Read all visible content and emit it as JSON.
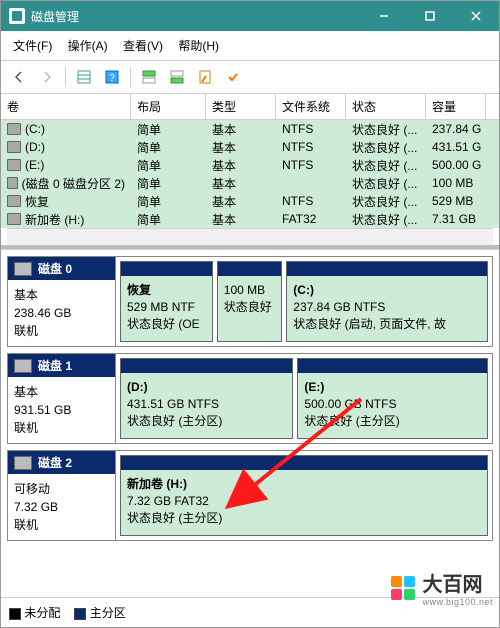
{
  "window": {
    "title": "磁盘管理"
  },
  "menu": {
    "file": "文件(F)",
    "action": "操作(A)",
    "view": "查看(V)",
    "help": "帮助(H)"
  },
  "columns": {
    "vol": "卷",
    "layout": "布局",
    "type": "类型",
    "fs": "文件系统",
    "status": "状态",
    "cap": "容量"
  },
  "rows": [
    {
      "vol": "(C:)",
      "layout": "简单",
      "type": "基本",
      "fs": "NTFS",
      "status": "状态良好 (...",
      "cap": "237.84 G"
    },
    {
      "vol": "(D:)",
      "layout": "简单",
      "type": "基本",
      "fs": "NTFS",
      "status": "状态良好 (...",
      "cap": "431.51 G"
    },
    {
      "vol": "(E:)",
      "layout": "简单",
      "type": "基本",
      "fs": "NTFS",
      "status": "状态良好 (...",
      "cap": "500.00 G"
    },
    {
      "vol": "(磁盘 0 磁盘分区 2)",
      "layout": "简单",
      "type": "基本",
      "fs": "",
      "status": "状态良好 (...",
      "cap": "100 MB"
    },
    {
      "vol": "恢复",
      "layout": "简单",
      "type": "基本",
      "fs": "NTFS",
      "status": "状态良好 (...",
      "cap": "529 MB"
    },
    {
      "vol": "新加卷 (H:)",
      "layout": "简单",
      "type": "基本",
      "fs": "FAT32",
      "status": "状态良好 (...",
      "cap": "7.31 GB"
    }
  ],
  "disks": [
    {
      "name": "磁盘 0",
      "type": "基本",
      "size": "238.46 GB",
      "state": "联机",
      "parts": [
        {
          "title": "恢复",
          "line1": "529 MB NTF",
          "line2": "状态良好 (OE",
          "flex": 1
        },
        {
          "title": "",
          "line1": "100 MB",
          "line2": "状态良好",
          "flex": 0.7
        },
        {
          "title": "(C:)",
          "line1": "237.84 GB NTFS",
          "line2": "状态良好 (启动, 页面文件, 故",
          "flex": 2.2
        }
      ]
    },
    {
      "name": "磁盘 1",
      "type": "基本",
      "size": "931.51 GB",
      "state": "联机",
      "parts": [
        {
          "title": "(D:)",
          "line1": "431.51 GB NTFS",
          "line2": "状态良好 (主分区)",
          "flex": 1
        },
        {
          "title": "(E:)",
          "line1": "500.00 GB NTFS",
          "line2": "状态良好 (主分区)",
          "flex": 1.1
        }
      ]
    },
    {
      "name": "磁盘 2",
      "type": "可移动",
      "size": "7.32 GB",
      "state": "联机",
      "parts": [
        {
          "title": "新加卷  (H:)",
          "line1": "7.32 GB FAT32",
          "line2": "状态良好 (主分区)",
          "flex": 1
        }
      ]
    }
  ],
  "legend": {
    "unalloc": "未分配",
    "primary": "主分区"
  },
  "watermark": {
    "cn": "大百网",
    "url": "www.big100.net"
  },
  "colors": {
    "titlebar": "#2f8e8e",
    "parthead": "#0b2a6b",
    "partbody": "#cdebd6",
    "unalloc": "#000000"
  }
}
